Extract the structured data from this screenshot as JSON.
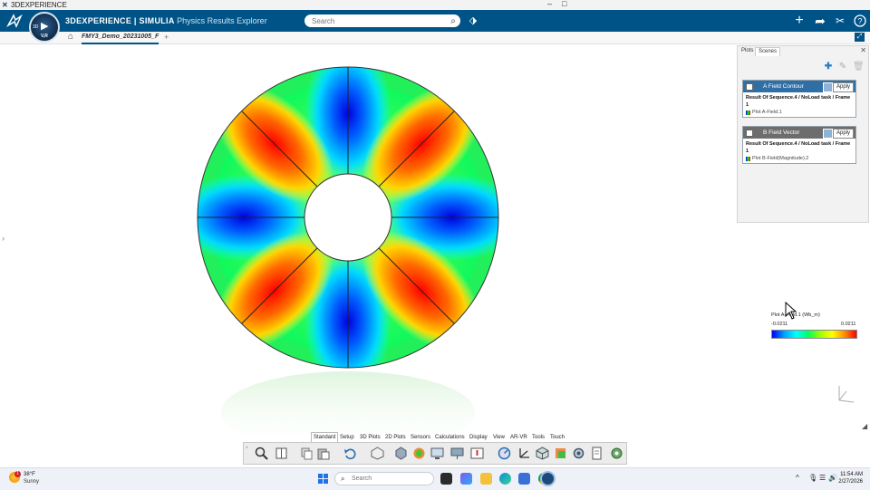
{
  "window": {
    "title": "3DEXPERIENCE"
  },
  "header": {
    "brand_bold": "3DEXPERIENCE | SIMULIA",
    "brand_app": "Physics Results Explorer",
    "search_placeholder": "Search",
    "compass_label": "V,R"
  },
  "tabbar": {
    "tab_label": "FMY3_Demo_20231005_F"
  },
  "panel": {
    "tabs": [
      "Plots",
      "Scenes"
    ],
    "cards": [
      {
        "name": "A Field Contour",
        "apply": "Apply",
        "result": "Result Of Sequence.4 / NoLoad task / Frame 1",
        "plot": "Plot A-Field.1",
        "header_color": "#2f6fa5"
      },
      {
        "name": "B Field Vector",
        "apply": "Apply",
        "result": "Result Of Sequence.4 / NoLoad task / Frame 1",
        "plot": "Plot B-Field(Magnitude).2",
        "header_color": "#6d6d6d"
      }
    ]
  },
  "legend": {
    "title": "Plot A-Field.1 (Wb_m)",
    "min": "-0.0211",
    "max": "0.0211",
    "colors": [
      "#0000ff",
      "#00ffff",
      "#00ff60",
      "#ffff00",
      "#ff0000"
    ]
  },
  "toolbar": {
    "tabs": [
      "Standard",
      "Setup",
      "3D Plots",
      "2D Plots",
      "Sensors",
      "Calculations",
      "Display",
      "View",
      "AR-VR",
      "Tools",
      "Touch"
    ],
    "active_tab": "Standard"
  },
  "taskbar": {
    "temperature": "38°F",
    "condition": "Sunny",
    "badge": "1",
    "search_placeholder": "Search",
    "time": "11:54 AM",
    "date": "2/27/2026"
  }
}
